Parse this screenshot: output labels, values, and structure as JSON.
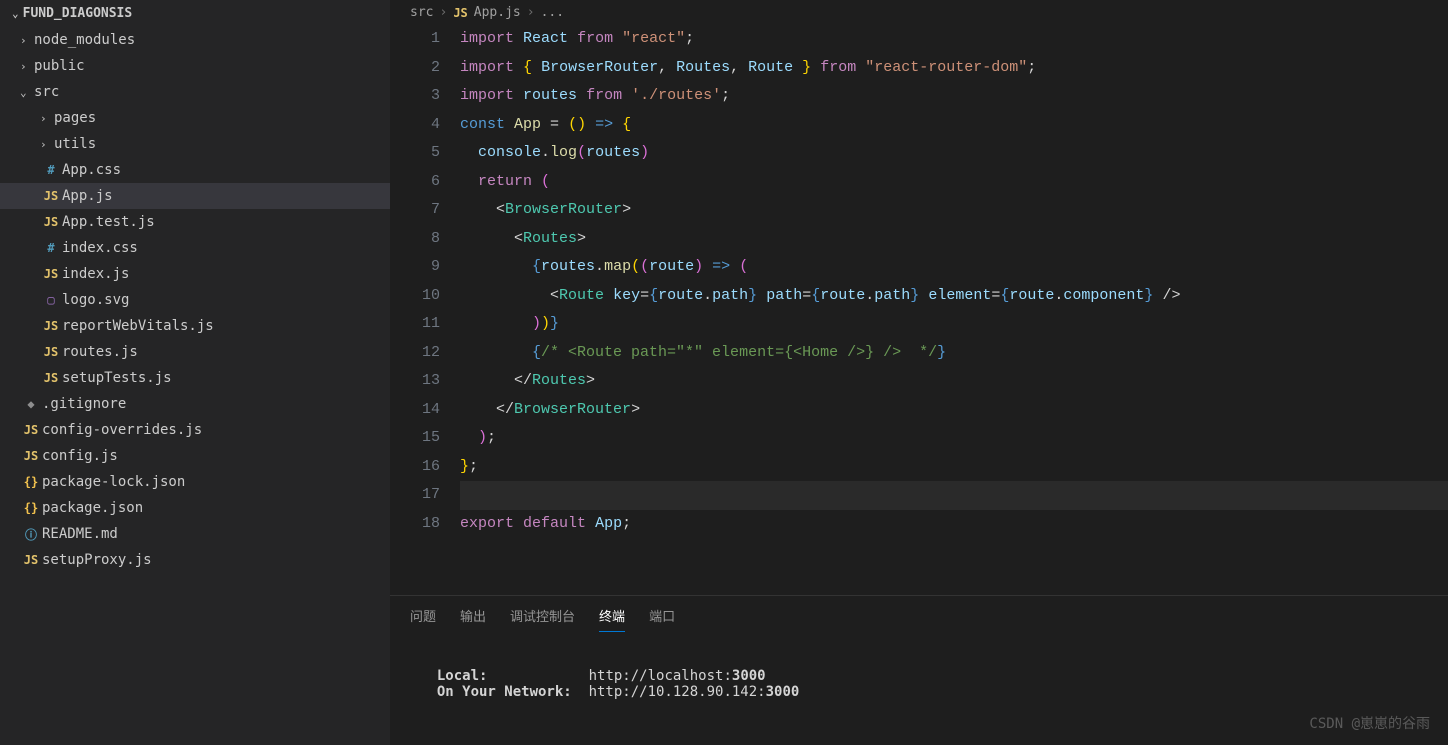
{
  "project": {
    "name": "FUND_DIAGONSIS"
  },
  "tree": [
    {
      "type": "folder",
      "name": "node_modules",
      "indent": 1,
      "open": false
    },
    {
      "type": "folder",
      "name": "public",
      "indent": 1,
      "open": false
    },
    {
      "type": "folder",
      "name": "src",
      "indent": 1,
      "open": true
    },
    {
      "type": "folder",
      "name": "pages",
      "indent": 2,
      "open": false
    },
    {
      "type": "folder",
      "name": "utils",
      "indent": 2,
      "open": false
    },
    {
      "type": "file",
      "name": "App.css",
      "indent": 2,
      "icon": "css",
      "badge": "#"
    },
    {
      "type": "file",
      "name": "App.js",
      "indent": 2,
      "icon": "js",
      "badge": "JS",
      "selected": true
    },
    {
      "type": "file",
      "name": "App.test.js",
      "indent": 2,
      "icon": "js",
      "badge": "JS"
    },
    {
      "type": "file",
      "name": "index.css",
      "indent": 2,
      "icon": "css",
      "badge": "#"
    },
    {
      "type": "file",
      "name": "index.js",
      "indent": 2,
      "icon": "js",
      "badge": "JS"
    },
    {
      "type": "file",
      "name": "logo.svg",
      "indent": 2,
      "icon": "svg",
      "badge": "▢"
    },
    {
      "type": "file",
      "name": "reportWebVitals.js",
      "indent": 2,
      "icon": "js",
      "badge": "JS"
    },
    {
      "type": "file",
      "name": "routes.js",
      "indent": 2,
      "icon": "js",
      "badge": "JS"
    },
    {
      "type": "file",
      "name": "setupTests.js",
      "indent": 2,
      "icon": "js",
      "badge": "JS"
    },
    {
      "type": "file",
      "name": ".gitignore",
      "indent": 1,
      "icon": "git",
      "badge": "◆"
    },
    {
      "type": "file",
      "name": "config-overrides.js",
      "indent": 1,
      "icon": "js",
      "badge": "JS"
    },
    {
      "type": "file",
      "name": "config.js",
      "indent": 1,
      "icon": "js",
      "badge": "JS"
    },
    {
      "type": "file",
      "name": "package-lock.json",
      "indent": 1,
      "icon": "json",
      "badge": "{}"
    },
    {
      "type": "file",
      "name": "package.json",
      "indent": 1,
      "icon": "json",
      "badge": "{}"
    },
    {
      "type": "file",
      "name": "README.md",
      "indent": 1,
      "icon": "md",
      "badge": "ⓘ"
    },
    {
      "type": "file",
      "name": "setupProxy.js",
      "indent": 1,
      "icon": "js",
      "badge": "JS"
    }
  ],
  "breadcrumb": {
    "root": "src",
    "icon": "JS",
    "file": "App.js",
    "dots": "..."
  },
  "code": {
    "lines": [
      [
        [
          "k",
          "import"
        ],
        [
          "p",
          " "
        ],
        [
          "v",
          "React"
        ],
        [
          "p",
          " "
        ],
        [
          "k",
          "from"
        ],
        [
          "p",
          " "
        ],
        [
          "s",
          "\"react\""
        ],
        [
          "p",
          ";"
        ]
      ],
      [
        [
          "k",
          "import"
        ],
        [
          "p",
          " "
        ],
        [
          "y",
          "{"
        ],
        [
          "p",
          " "
        ],
        [
          "v",
          "BrowserRouter"
        ],
        [
          "p",
          ", "
        ],
        [
          "v",
          "Routes"
        ],
        [
          "p",
          ", "
        ],
        [
          "v",
          "Route"
        ],
        [
          "p",
          " "
        ],
        [
          "y",
          "}"
        ],
        [
          "p",
          " "
        ],
        [
          "k",
          "from"
        ],
        [
          "p",
          " "
        ],
        [
          "s",
          "\"react-router-dom\""
        ],
        [
          "p",
          ";"
        ]
      ],
      [
        [
          "k",
          "import"
        ],
        [
          "p",
          " "
        ],
        [
          "v",
          "routes"
        ],
        [
          "p",
          " "
        ],
        [
          "k",
          "from"
        ],
        [
          "p",
          " "
        ],
        [
          "s",
          "'./routes'"
        ],
        [
          "p",
          ";"
        ]
      ],
      [
        [
          "n",
          "const"
        ],
        [
          "p",
          " "
        ],
        [
          "f",
          "App"
        ],
        [
          "p",
          " = "
        ],
        [
          "y",
          "("
        ],
        [
          "y",
          ")"
        ],
        [
          "p",
          " "
        ],
        [
          "n",
          "=>"
        ],
        [
          "p",
          " "
        ],
        [
          "y",
          "{"
        ]
      ],
      [
        [
          "p",
          "  "
        ],
        [
          "v",
          "console"
        ],
        [
          "p",
          "."
        ],
        [
          "f",
          "log"
        ],
        [
          "pk",
          "("
        ],
        [
          "v",
          "routes"
        ],
        [
          "pk",
          ")"
        ]
      ],
      [
        [
          "p",
          "  "
        ],
        [
          "k",
          "return"
        ],
        [
          "p",
          " "
        ],
        [
          "pk",
          "("
        ]
      ],
      [
        [
          "p",
          "    "
        ],
        [
          "p",
          "<"
        ],
        [
          "t",
          "BrowserRouter"
        ],
        [
          "p",
          ">"
        ]
      ],
      [
        [
          "p",
          "      "
        ],
        [
          "p",
          "<"
        ],
        [
          "t",
          "Routes"
        ],
        [
          "p",
          ">"
        ]
      ],
      [
        [
          "p",
          "        "
        ],
        [
          "n",
          "{"
        ],
        [
          "v",
          "routes"
        ],
        [
          "p",
          "."
        ],
        [
          "f",
          "map"
        ],
        [
          "y",
          "("
        ],
        [
          "pk",
          "("
        ],
        [
          "v",
          "route"
        ],
        [
          "pk",
          ")"
        ],
        [
          "p",
          " "
        ],
        [
          "n",
          "=>"
        ],
        [
          "p",
          " "
        ],
        [
          "pk",
          "("
        ]
      ],
      [
        [
          "p",
          "          "
        ],
        [
          "p",
          "<"
        ],
        [
          "t",
          "Route"
        ],
        [
          "p",
          " "
        ],
        [
          "a",
          "key"
        ],
        [
          "p",
          "="
        ],
        [
          "n",
          "{"
        ],
        [
          "v",
          "route"
        ],
        [
          "p",
          "."
        ],
        [
          "v",
          "path"
        ],
        [
          "n",
          "}"
        ],
        [
          "p",
          " "
        ],
        [
          "a",
          "path"
        ],
        [
          "p",
          "="
        ],
        [
          "n",
          "{"
        ],
        [
          "v",
          "route"
        ],
        [
          "p",
          "."
        ],
        [
          "v",
          "path"
        ],
        [
          "n",
          "}"
        ],
        [
          "p",
          " "
        ],
        [
          "a",
          "element"
        ],
        [
          "p",
          "="
        ],
        [
          "n",
          "{"
        ],
        [
          "v",
          "route"
        ],
        [
          "p",
          "."
        ],
        [
          "v",
          "component"
        ],
        [
          "n",
          "}"
        ],
        [
          "p",
          " "
        ],
        [
          "p",
          "/>"
        ]
      ],
      [
        [
          "p",
          "        "
        ],
        [
          "pk",
          ")"
        ],
        [
          "y",
          ")"
        ],
        [
          "n",
          "}"
        ]
      ],
      [
        [
          "p",
          "        "
        ],
        [
          "n",
          "{"
        ],
        [
          "c",
          "/* <Route path=\"*\" element={<Home />} />  */"
        ],
        [
          "n",
          "}"
        ]
      ],
      [
        [
          "p",
          "      "
        ],
        [
          "p",
          "</"
        ],
        [
          "t",
          "Routes"
        ],
        [
          "p",
          ">"
        ]
      ],
      [
        [
          "p",
          "    "
        ],
        [
          "p",
          "</"
        ],
        [
          "t",
          "BrowserRouter"
        ],
        [
          "p",
          ">"
        ]
      ],
      [
        [
          "p",
          "  "
        ],
        [
          "pk",
          ")"
        ],
        [
          "p",
          ";"
        ]
      ],
      [
        [
          "y",
          "}"
        ],
        [
          "p",
          ";"
        ]
      ],
      [
        [
          "p",
          ""
        ]
      ],
      [
        [
          "k",
          "export"
        ],
        [
          "p",
          " "
        ],
        [
          "k",
          "default"
        ],
        [
          "p",
          " "
        ],
        [
          "v",
          "App"
        ],
        [
          "p",
          ";"
        ]
      ]
    ],
    "currentLine": 17
  },
  "panel": {
    "tabs": [
      "问题",
      "输出",
      "调试控制台",
      "终端",
      "端口"
    ],
    "active": 3,
    "terminal": {
      "line1_label": "Local:",
      "line1_url_prefix": "http://localhost:",
      "line1_port": "3000",
      "line2_label": "On Your Network:",
      "line2_url_prefix": "http://10.128.90.142:",
      "line2_port": "3000"
    }
  },
  "watermark": "CSDN @崽崽的谷雨"
}
